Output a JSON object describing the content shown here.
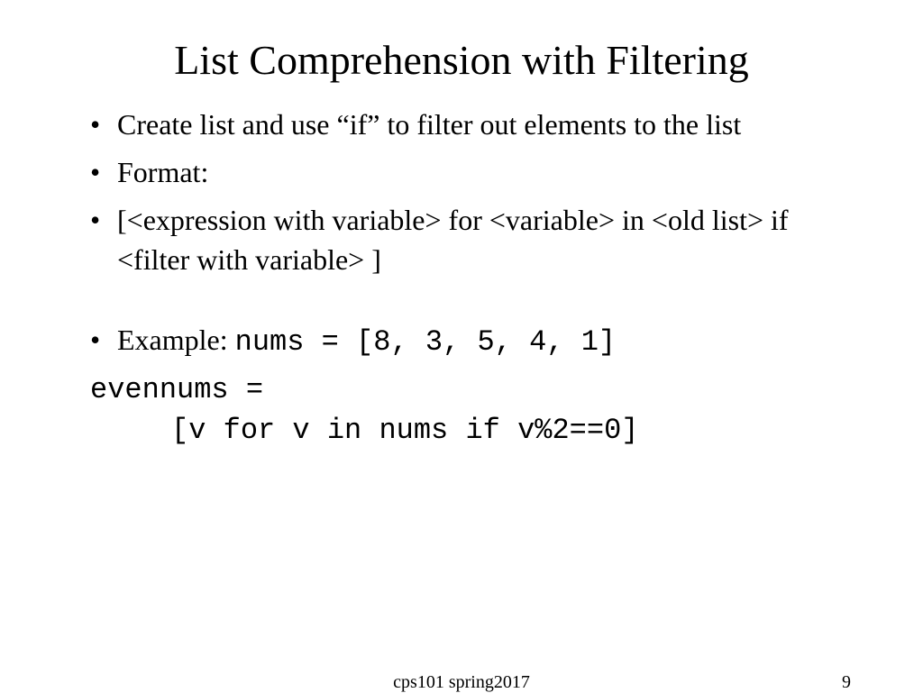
{
  "slide": {
    "title": "List Comprehension with Filtering",
    "bullets": {
      "b1": "Create list and use “if” to filter out elements to the list",
      "b2": "Format:",
      "b3": "[<expression with variable> for <variable> in <old list> if <filter with variable> ]",
      "b4_prefix": "Example: ",
      "b4_code": "nums = [8, 3, 5, 4, 1]"
    },
    "code": {
      "line1": "evennums =",
      "line2": "[v for v in nums if v%2==0]"
    },
    "footer": {
      "center": "cps101 spring2017",
      "page": "9"
    }
  }
}
